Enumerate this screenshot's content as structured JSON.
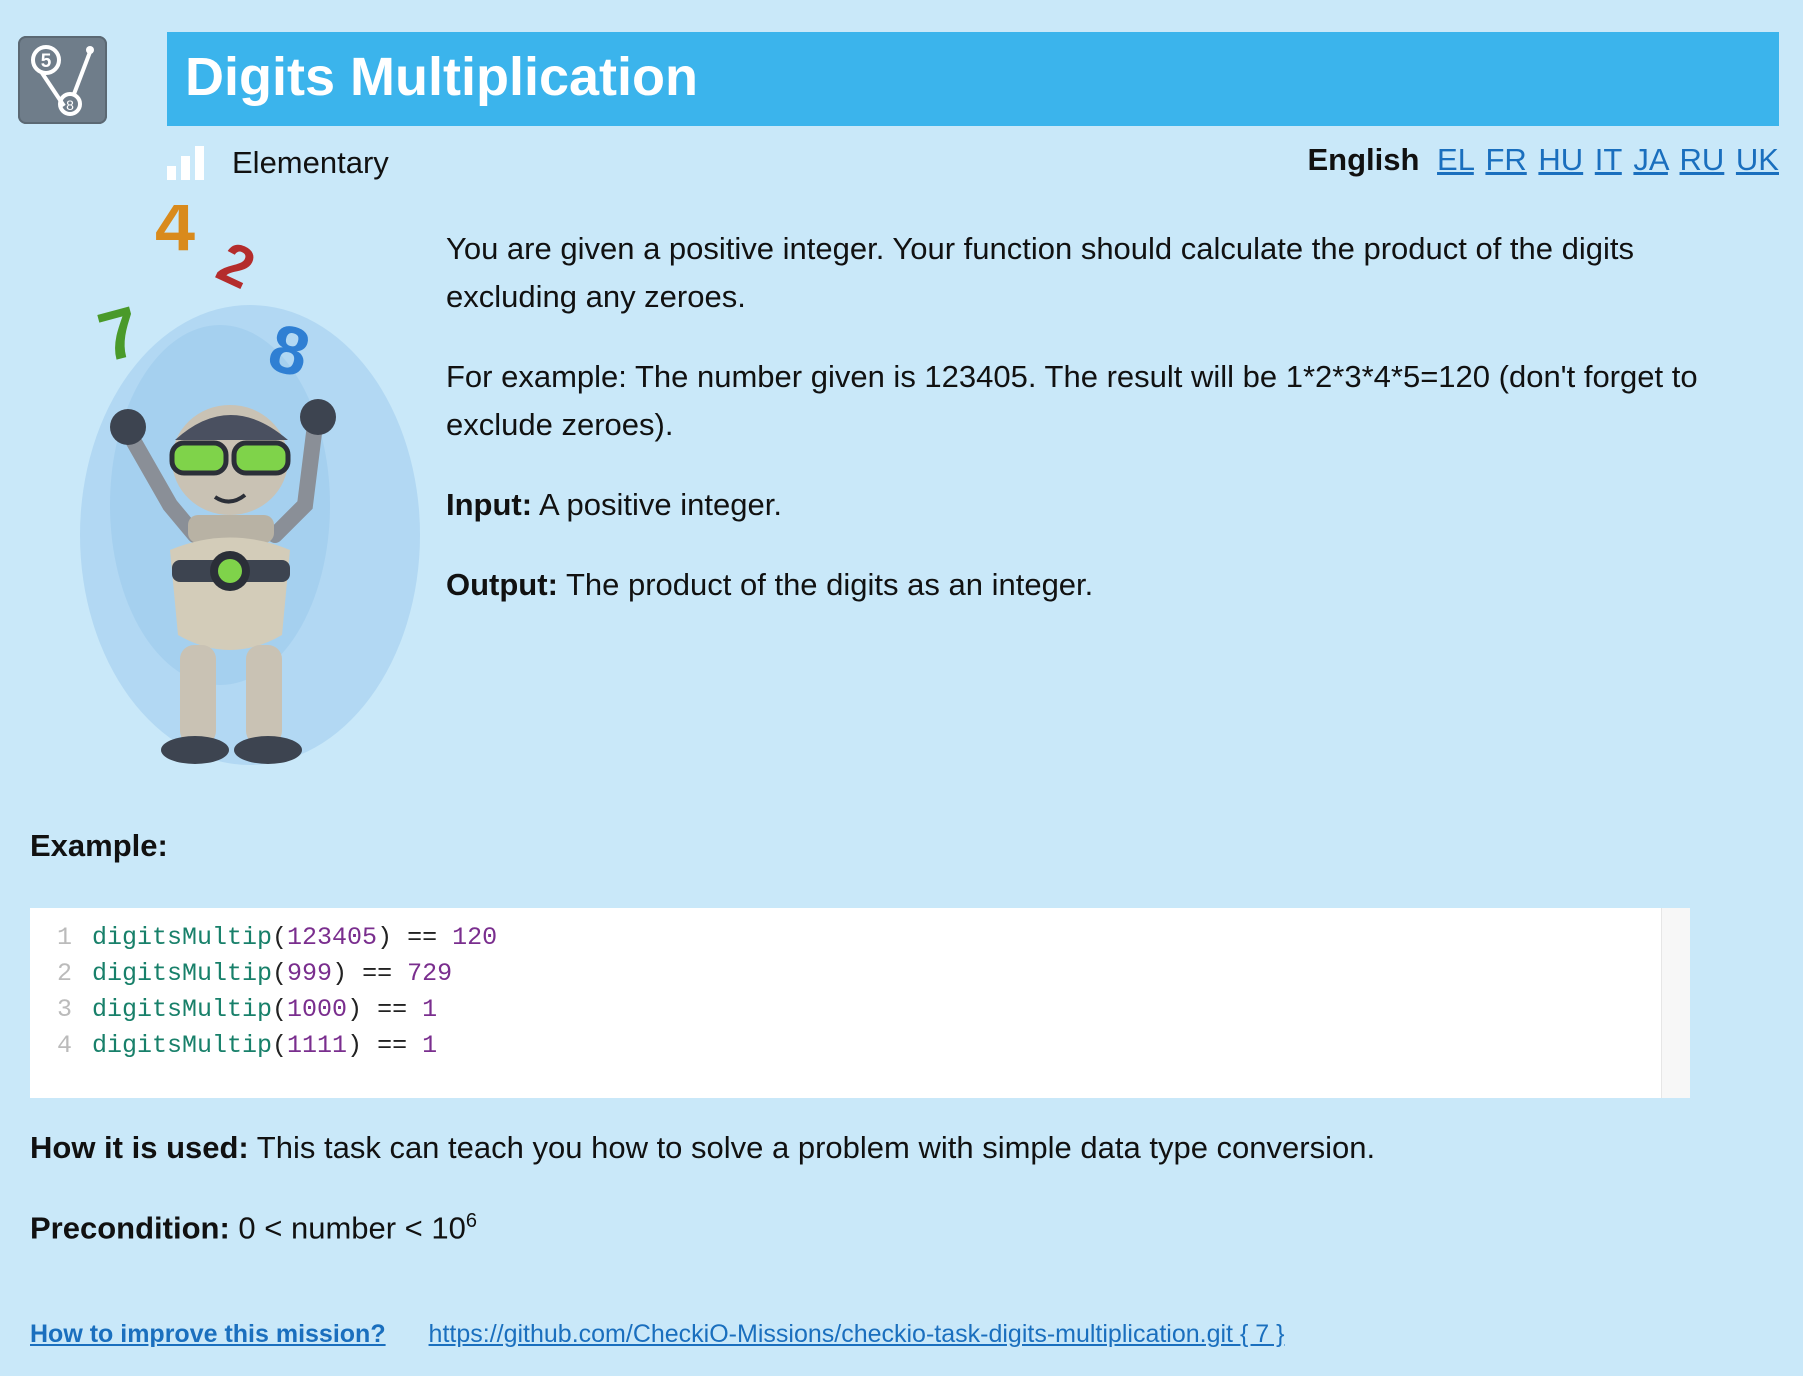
{
  "header": {
    "title": "Digits Multiplication",
    "difficulty": "Elementary"
  },
  "languages": {
    "current": "English",
    "links": [
      "EL",
      "FR",
      "HU",
      "IT",
      "JA",
      "RU",
      "UK"
    ]
  },
  "description": {
    "p1": "You are given a positive integer. Your function should calculate the product of the digits excluding any zeroes.",
    "p2": "For example: The number given is 123405. The result will be 1*2*3*4*5=120 (don't forget to exclude zeroes).",
    "input_label": "Input:",
    "input_text": " A positive integer.",
    "output_label": "Output:",
    "output_text": " The product of the digits as an integer."
  },
  "example": {
    "title": "Example:",
    "lines": [
      {
        "n": "1",
        "fn": "digitsMultip",
        "arg": "123405",
        "result": "120"
      },
      {
        "n": "2",
        "fn": "digitsMultip",
        "arg": "999",
        "result": "729"
      },
      {
        "n": "3",
        "fn": "digitsMultip",
        "arg": "1000",
        "result": "1"
      },
      {
        "n": "4",
        "fn": "digitsMultip",
        "arg": "1111",
        "result": "1"
      }
    ]
  },
  "usage": {
    "label": "How it is used:",
    "text": " This task can teach you how to solve a problem with simple data type conversion."
  },
  "precondition": {
    "label": "Precondition:",
    "text": " 0 < number < 10",
    "exp": "6"
  },
  "footer": {
    "improve": "How to improve this mission?",
    "repo": "https://github.com/CheckiO-Missions/checkio-task-digits-multiplication.git { 7 }"
  },
  "robot_digits": [
    "4",
    "2",
    "7",
    "8"
  ]
}
